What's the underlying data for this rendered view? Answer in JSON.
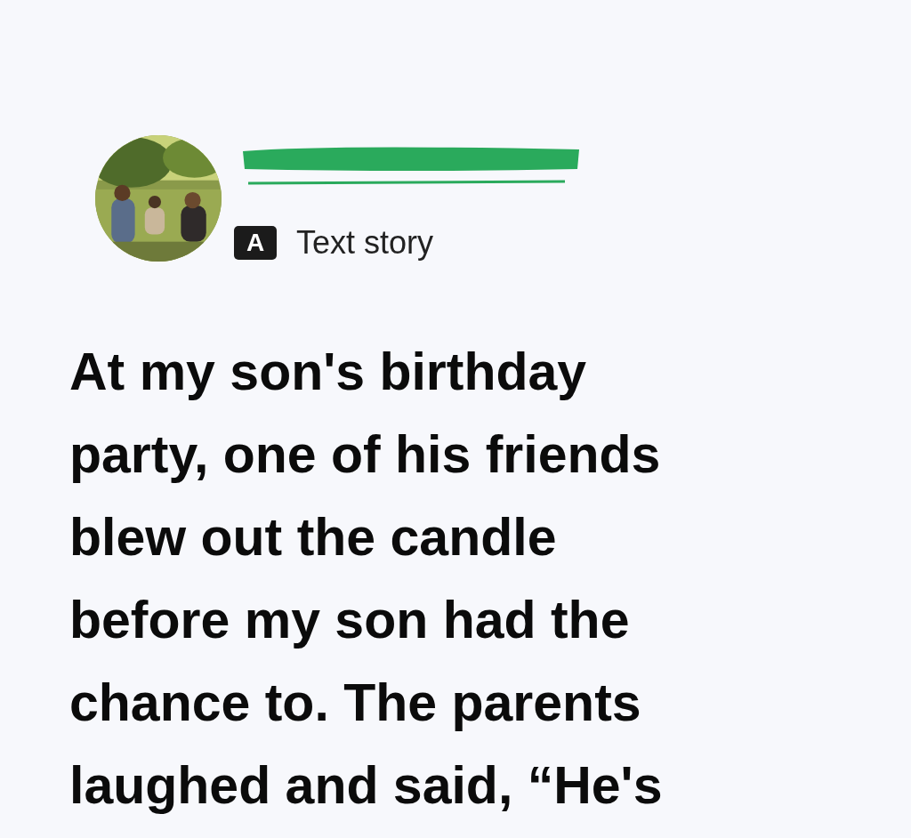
{
  "post": {
    "author_redacted": true,
    "badge": {
      "letter": "A",
      "label": "Text story"
    },
    "title_lines": [
      "At my son's birthday",
      "party, one of his friends",
      "blew out the candle",
      "before my son had the",
      "chance to. The parents",
      "laughed and said, “He's"
    ]
  }
}
